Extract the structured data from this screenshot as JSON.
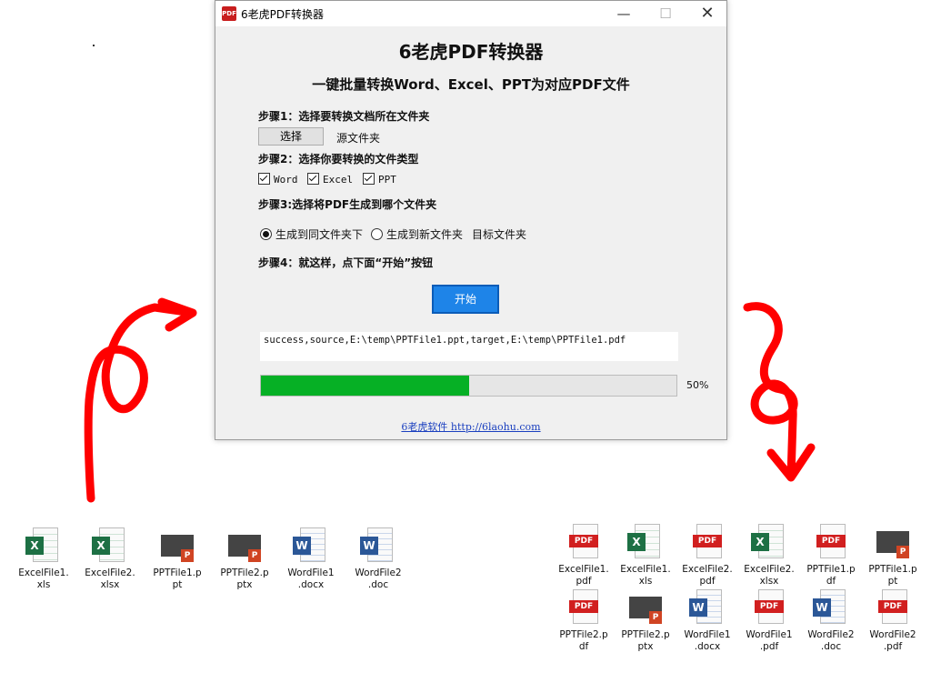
{
  "window": {
    "title": "6老虎PDF转换器",
    "heading": "6老虎PDF转换器",
    "subheading": "一键批量转换Word、Excel、PPT为对应PDF文件",
    "step1": "步骤1：选择要转换文档所在文件夹",
    "select_button": "选择",
    "source_label": "源文件夹",
    "step2": "步骤2：选择你要转换的文件类型",
    "checkboxes": [
      "Word",
      "Excel",
      "PPT"
    ],
    "step3": "步骤3:选择将PDF生成到哪个文件夹",
    "radio_same": "生成到同文件夹下",
    "radio_new": "生成到新文件夹",
    "target_label": "目标文件夹",
    "step4": "步骤4：就这样，点下面“开始”按钮",
    "start_button": "开始",
    "log_text": "success,source,E:\\temp\\PPTFile1.ppt,target,E:\\temp\\PPTFile1.pdf",
    "progress": 0.5,
    "progress_label": "50%",
    "footer_link": "6老虎软件 http://6laohu.com",
    "colors": {
      "accent": "#1e84e8",
      "progress": "#06b025",
      "annotation": "#ff0000"
    }
  },
  "source_files": [
    {
      "name": "ExcelFile1.\nxls",
      "icon": "excel-icon"
    },
    {
      "name": "ExcelFile2.\nxlsx",
      "icon": "excel-icon"
    },
    {
      "name": "PPTFile1.p\npt",
      "icon": "ppt-icon"
    },
    {
      "name": "PPTFile2.p\nptx",
      "icon": "ppt-icon"
    },
    {
      "name": "WordFile1\n.docx",
      "icon": "word-icon"
    },
    {
      "name": "WordFile2\n.doc",
      "icon": "word-icon"
    }
  ],
  "result_files": [
    {
      "name": "ExcelFile1.\npdf",
      "icon": "pdf-icon"
    },
    {
      "name": "ExcelFile1.\nxls",
      "icon": "excel-icon"
    },
    {
      "name": "ExcelFile2.\npdf",
      "icon": "pdf-icon"
    },
    {
      "name": "ExcelFile2.\nxlsx",
      "icon": "excel-icon"
    },
    {
      "name": "PPTFile1.p\ndf",
      "icon": "pdf-icon"
    },
    {
      "name": "PPTFile1.p\npt",
      "icon": "ppt-icon"
    },
    {
      "name": "PPTFile2.p\ndf",
      "icon": "pdf-icon"
    },
    {
      "name": "PPTFile2.p\nptx",
      "icon": "ppt-icon"
    },
    {
      "name": "WordFile1\n.docx",
      "icon": "word-icon"
    },
    {
      "name": "WordFile1\n.pdf",
      "icon": "pdf-icon"
    },
    {
      "name": "WordFile2\n.doc",
      "icon": "word-icon"
    },
    {
      "name": "WordFile2\n.pdf",
      "icon": "pdf-icon"
    }
  ]
}
